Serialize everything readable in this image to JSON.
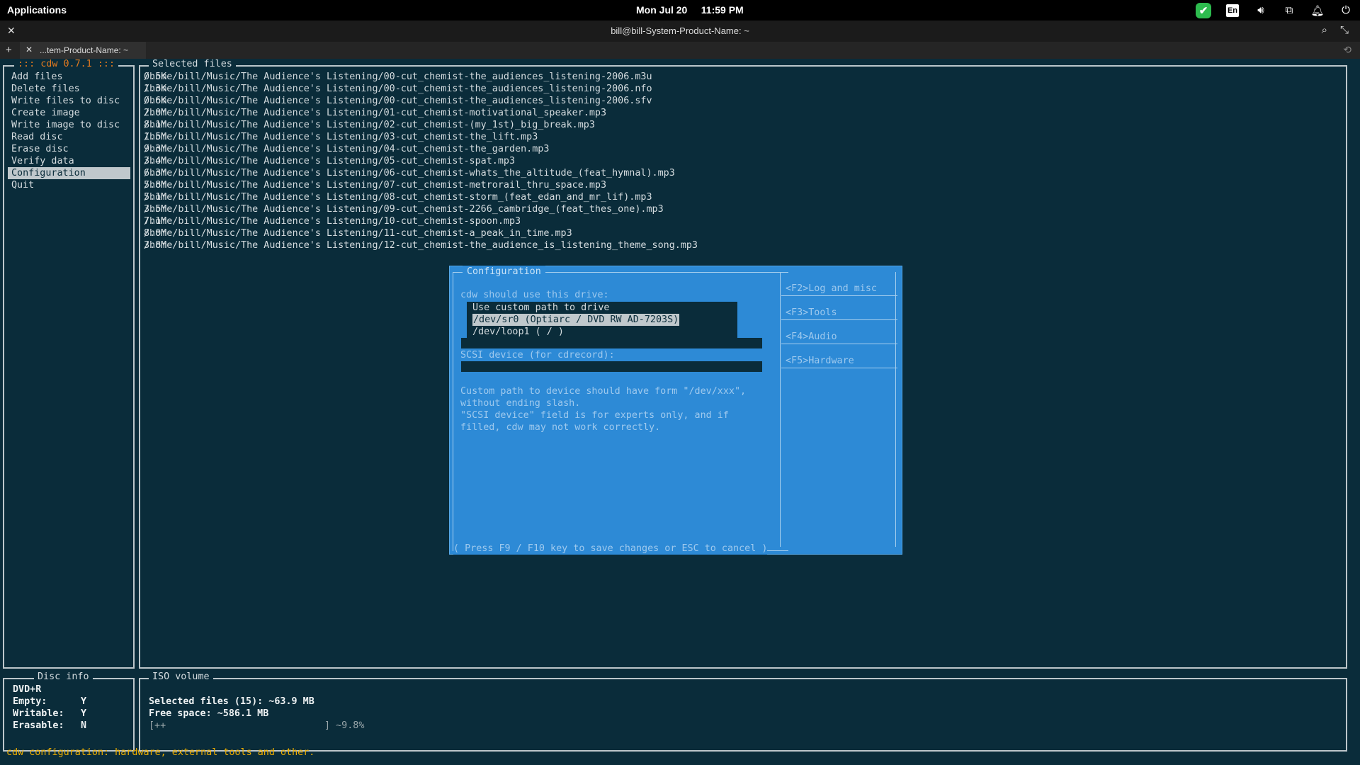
{
  "topbar": {
    "applications": "Applications",
    "datetime": "Mon Jul 20     11:59 PM",
    "tray": {
      "language": "En",
      "icons": [
        "check-badge-icon",
        "keyboard-layout-icon",
        "volume-icon",
        "network-icon",
        "bell-icon",
        "power-icon"
      ]
    }
  },
  "window": {
    "title": "bill@bill-System-Product-Name: ~",
    "tab_label": "...tem-Product-Name: ~"
  },
  "cdw": {
    "menu_title": "::: cdw 0.7.1 :::",
    "menu_items": [
      "Add files",
      "Delete files",
      "Write files to disc",
      "Create image",
      "Write image to disc",
      "Read disc",
      "Erase disc",
      "Verify data",
      "Configuration",
      "Quit"
    ],
    "selected_menu": "Configuration",
    "files_title": "Selected files",
    "files": [
      {
        "path": "/home/bill/Music/The Audience's Listening/00-cut_chemist-the_audiences_listening-2006.m3u",
        "size": "0.5K"
      },
      {
        "path": "/home/bill/Music/The Audience's Listening/00-cut_chemist-the_audiences_listening-2006.nfo",
        "size": "1.3K"
      },
      {
        "path": "/home/bill/Music/The Audience's Listening/00-cut_chemist-the_audiences_listening-2006.sfv",
        "size": "0.6K"
      },
      {
        "path": "/home/bill/Music/The Audience's Listening/01-cut_chemist-motivational_speaker.mp3",
        "size": "2.0M"
      },
      {
        "path": "/home/bill/Music/The Audience's Listening/02-cut_chemist-(my_1st)_big_break.mp3",
        "size": "8.1M"
      },
      {
        "path": "/home/bill/Music/The Audience's Listening/03-cut_chemist-the_lift.mp3",
        "size": "1.5M"
      },
      {
        "path": "/home/bill/Music/The Audience's Listening/04-cut_chemist-the_garden.mp3",
        "size": "9.3M"
      },
      {
        "path": "/home/bill/Music/The Audience's Listening/05-cut_chemist-spat.mp3",
        "size": "3.4M"
      },
      {
        "path": "/home/bill/Music/The Audience's Listening/06-cut_chemist-whats_the_altitude_(feat_hymnal).mp3",
        "size": "6.3M"
      },
      {
        "path": "/home/bill/Music/The Audience's Listening/07-cut_chemist-metrorail_thru_space.mp3",
        "size": "5.8M"
      },
      {
        "path": "/home/bill/Music/The Audience's Listening/08-cut_chemist-storm_(feat_edan_and_mr_lif).mp3",
        "size": "5.1M"
      },
      {
        "path": "/home/bill/Music/The Audience's Listening/09-cut_chemist-2266_cambridge_(feat_thes_one).mp3",
        "size": "3.5M"
      },
      {
        "path": "/home/bill/Music/The Audience's Listening/10-cut_chemist-spoon.mp3",
        "size": "7.1M"
      },
      {
        "path": "/home/bill/Music/The Audience's Listening/11-cut_chemist-a_peak_in_time.mp3",
        "size": "8.0M"
      },
      {
        "path": "/home/bill/Music/The Audience's Listening/12-cut_chemist-the_audience_is_listening_theme_song.mp3",
        "size": "3.8M"
      }
    ],
    "disc_info": {
      "title": "Disc info",
      "type": "DVD+R",
      "rows": [
        {
          "label": "Empty:",
          "value": "Y"
        },
        {
          "label": "Writable:",
          "value": "Y"
        },
        {
          "label": "Erasable:",
          "value": "N"
        }
      ]
    },
    "iso_volume": {
      "title": "ISO volume",
      "selected": "Selected files (15): ~63.9 MB",
      "free": "Free space: ~586.1 MB",
      "bar_open": "[++",
      "bar_close": "] ~9.8%",
      "percent": 9.8
    },
    "status_line": "cdw configuration: hardware, external tools and other.",
    "config_dialog": {
      "title": "Configuration",
      "drive_label": "cdw should use this drive:",
      "drive_options": [
        "Use custom path to drive",
        "/dev/sr0 (Optiarc / DVD RW AD-7203S)",
        "/dev/loop1 ( / )"
      ],
      "selected_option": "/dev/sr0 (Optiarc / DVD RW AD-7203S)",
      "scsi_label": "SCSI device (for cdrecord):",
      "help_lines": [
        "Custom path to device should have form \"/dev/xxx\",",
        "without ending slash.",
        "\"SCSI device\" field is for experts only, and if",
        "filled, cdw may not work correctly."
      ],
      "footer": "( Press F9 / F10 key to save changes or ESC to cancel )",
      "tabs": [
        "<F2>Log and misc",
        "<F3>Tools",
        "<F4>Audio",
        "<F5>Hardware"
      ]
    }
  }
}
